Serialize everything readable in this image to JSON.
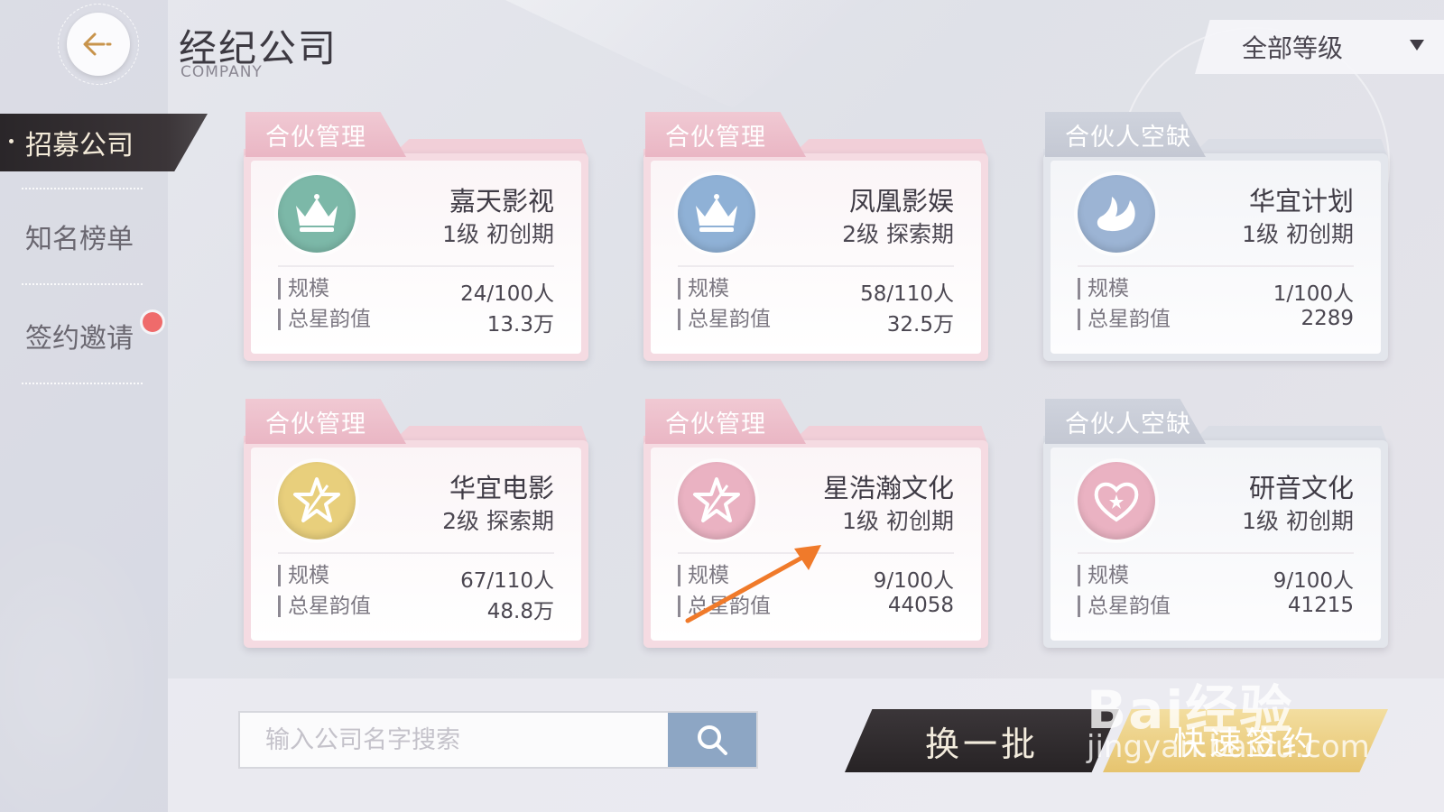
{
  "header": {
    "title": "经纪公司",
    "subtitle": "COMPANY",
    "level_filter": "全部等级"
  },
  "sidebar": {
    "items": [
      {
        "label": "招募公司",
        "active": true
      },
      {
        "label": "知名榜单",
        "active": false
      },
      {
        "label": "签约邀请",
        "active": false,
        "notification": true
      }
    ]
  },
  "cards": [
    {
      "tab": "合伙管理",
      "theme": "pink",
      "emblem": "crown-icon",
      "emblem_color": "#7cb8a8",
      "name": "嘉天影视",
      "level": "1级 初创期",
      "scale_label": "规模",
      "scale": "24/100人",
      "star_label": "总星韵值",
      "star": "13.3万"
    },
    {
      "tab": "合伙管理",
      "theme": "pink",
      "emblem": "crown-icon",
      "emblem_color": "#8fb1d6",
      "name": "凤凰影娱",
      "level": "2级 探索期",
      "scale_label": "规模",
      "scale": "58/110人",
      "star_label": "总星韵值",
      "star": "32.5万"
    },
    {
      "tab": "合伙人空缺",
      "theme": "gray",
      "emblem": "swan-icon",
      "emblem_color": "#9cb4d4",
      "name": "华宜计划",
      "level": "1级 初创期",
      "scale_label": "规模",
      "scale": "1/100人",
      "star_label": "总星韵值",
      "star": "2289"
    },
    {
      "tab": "合伙管理",
      "theme": "pink",
      "emblem": "star-icon",
      "emblem_color": "#e8cf7c",
      "name": "华宜电影",
      "level": "2级 探索期",
      "scale_label": "规模",
      "scale": "67/110人",
      "star_label": "总星韵值",
      "star": "48.8万"
    },
    {
      "tab": "合伙管理",
      "theme": "pink",
      "emblem": "star-icon",
      "emblem_color": "#eab2c2",
      "name": "星浩瀚文化",
      "level": "1级 初创期",
      "scale_label": "规模",
      "scale": "9/100人",
      "star_label": "总星韵值",
      "star": "44058"
    },
    {
      "tab": "合伙人空缺",
      "theme": "gray",
      "emblem": "heart-icon",
      "emblem_color": "#eab2c2",
      "name": "研音文化",
      "level": "1级 初创期",
      "scale_label": "规模",
      "scale": "9/100人",
      "star_label": "总星韵值",
      "star": "41215"
    }
  ],
  "search": {
    "placeholder": "输入公司名字搜索",
    "value": ""
  },
  "buttons": {
    "swap": "换一批",
    "quick_sign": "快速签约"
  },
  "watermark": {
    "line1": "Bai经验",
    "line2": "jingyan.baidu.com"
  },
  "colors": {
    "accent_dark": "#2a2629",
    "gold": "#e6c46f",
    "search_blue": "#8da6c4",
    "notification": "#ef6b6b",
    "annotation_arrow": "#f07a2a"
  }
}
